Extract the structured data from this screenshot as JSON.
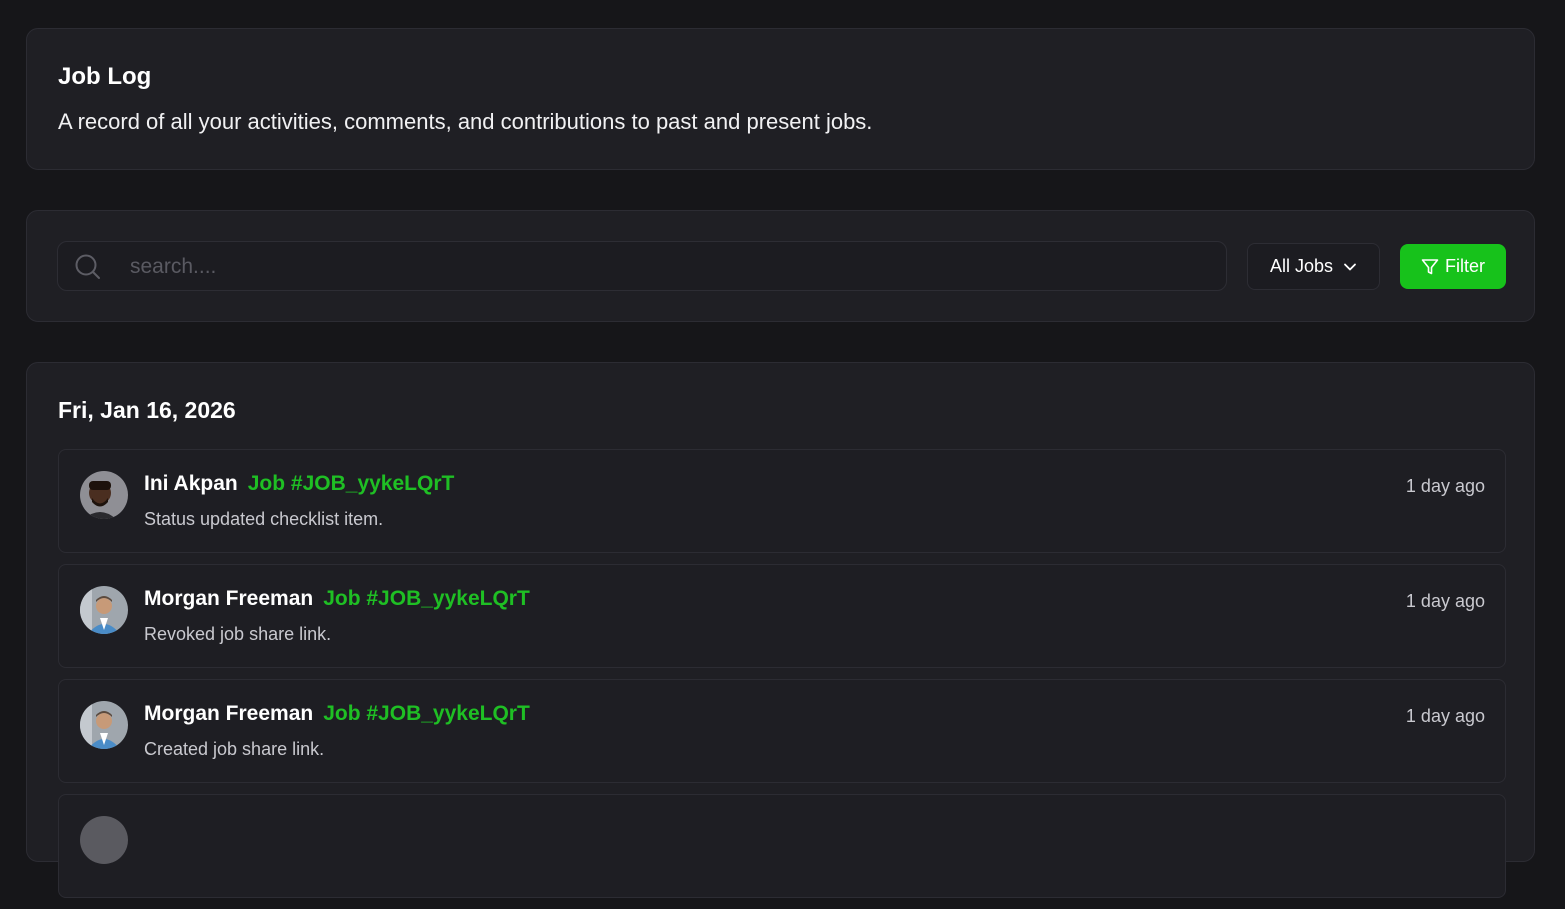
{
  "header": {
    "title": "Job Log",
    "subtitle": "A record of all your activities, comments, and contributions to past and present jobs."
  },
  "search": {
    "placeholder": "search....",
    "value": ""
  },
  "jobs_filter": {
    "selected": "All Jobs",
    "icon": "chevron-down-icon"
  },
  "filter_button": {
    "label": "Filter",
    "icon": "filter-icon",
    "color": "#17c21b"
  },
  "log": {
    "date": "Fri, Jan 16, 2026",
    "entries": [
      {
        "user": "Ini Akpan",
        "job": "Job #JOB_yykeLQrT",
        "description": "Status updated checklist item.",
        "time": "1 day ago"
      },
      {
        "user": "Morgan Freeman",
        "job": "Job #JOB_yykeLQrT",
        "description": "Revoked job share link.",
        "time": "1 day ago"
      },
      {
        "user": "Morgan Freeman",
        "job": "Job #JOB_yykeLQrT",
        "description": "Created job share link.",
        "time": "1 day ago"
      },
      {
        "user": "",
        "job": "",
        "description": "",
        "time": ""
      }
    ]
  },
  "colors": {
    "accent": "#17c21b",
    "job_link": "#1fbf24",
    "background": "#161619",
    "card": "#1f1f24"
  }
}
